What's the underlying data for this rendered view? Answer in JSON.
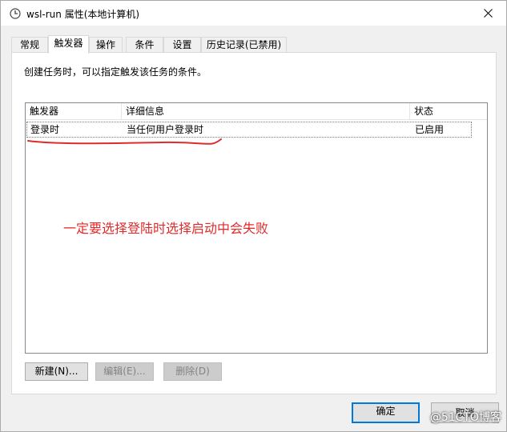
{
  "window": {
    "title": "wsl-run 属性(本地计算机)"
  },
  "tabs": [
    {
      "label": "常规"
    },
    {
      "label": "触发器"
    },
    {
      "label": "操作"
    },
    {
      "label": "条件"
    },
    {
      "label": "设置"
    },
    {
      "label": "历史记录(已禁用)"
    }
  ],
  "page": {
    "description": "创建任务时，可以指定触发该任务的条件。",
    "columns": [
      "触发器",
      "详细信息",
      "状态"
    ],
    "rows": [
      {
        "trigger": "登录时",
        "details": "当任何用户登录时",
        "status": "已启用"
      }
    ],
    "annotation": "一定要选择登陆时选择启动中会失败",
    "annotation_color": "#e02b2b"
  },
  "buttons": {
    "new": "新建(N)...",
    "edit": "编辑(E)...",
    "delete": "删除(D)",
    "ok": "确定",
    "cancel": "取消"
  },
  "watermark": "@51CTO博客",
  "colors": {
    "accent": "#0078d7"
  }
}
